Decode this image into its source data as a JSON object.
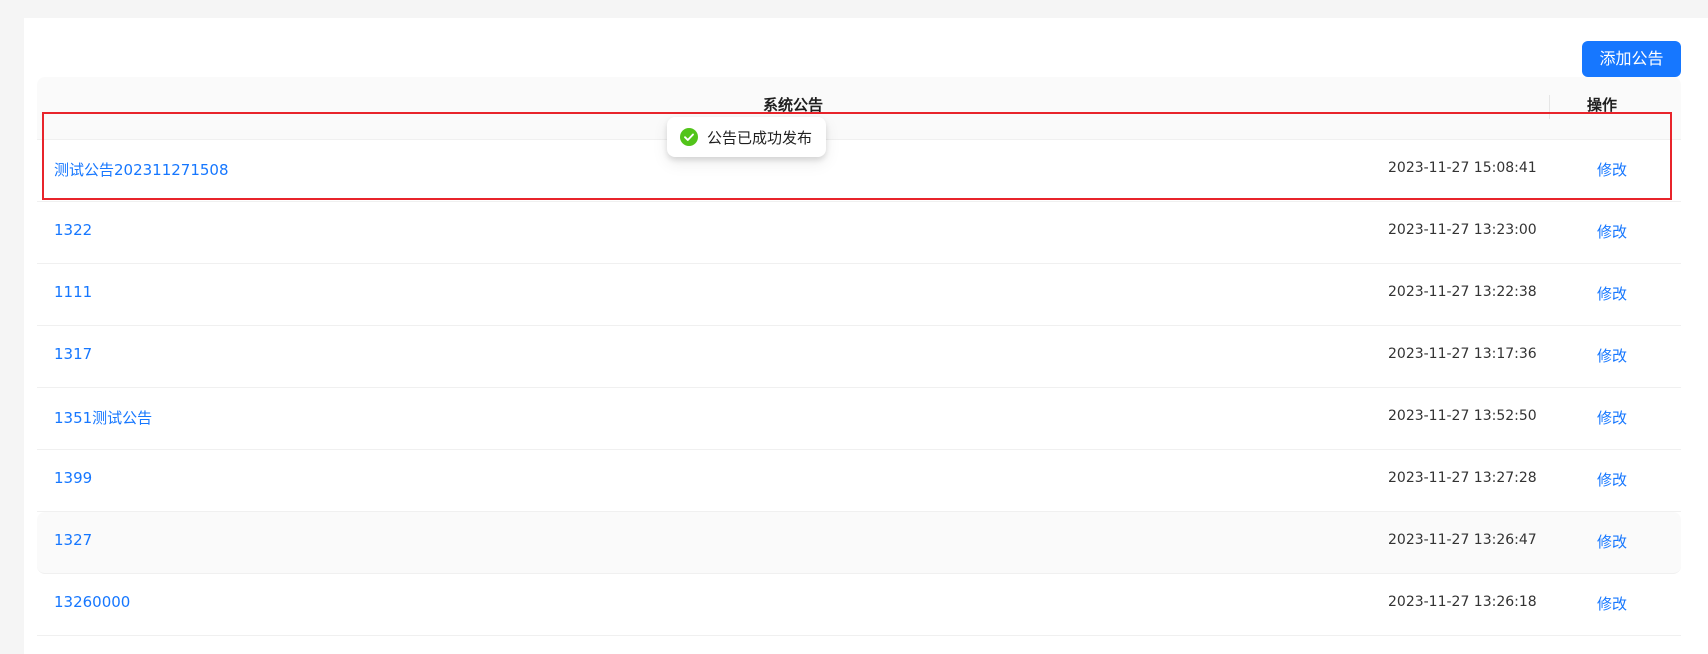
{
  "toolbar": {
    "add_label": "添加公告"
  },
  "table": {
    "headers": {
      "title": "系统公告",
      "action": "操作"
    },
    "rows": [
      {
        "title": "测试公告202311271508",
        "time": "2023-11-27 15:08:41",
        "action": "修改"
      },
      {
        "title": "1322",
        "time": "2023-11-27 13:23:00",
        "action": "修改"
      },
      {
        "title": "1111",
        "time": "2023-11-27 13:22:38",
        "action": "修改"
      },
      {
        "title": "1317",
        "time": "2023-11-27 13:17:36",
        "action": "修改"
      },
      {
        "title": "1351测试公告",
        "time": "2023-11-27 13:52:50",
        "action": "修改"
      },
      {
        "title": "1399",
        "time": "2023-11-27 13:27:28",
        "action": "修改"
      },
      {
        "title": "1327",
        "time": "2023-11-27 13:26:47",
        "action": "修改"
      },
      {
        "title": "13260000",
        "time": "2023-11-27 13:26:18",
        "action": "修改"
      }
    ]
  },
  "toast": {
    "message": "公告已成功发布",
    "icon": "check-circle-icon",
    "color": "#52c41a"
  },
  "colors": {
    "primary": "#1677ff",
    "highlight": "#e8242b",
    "success": "#52c41a"
  }
}
